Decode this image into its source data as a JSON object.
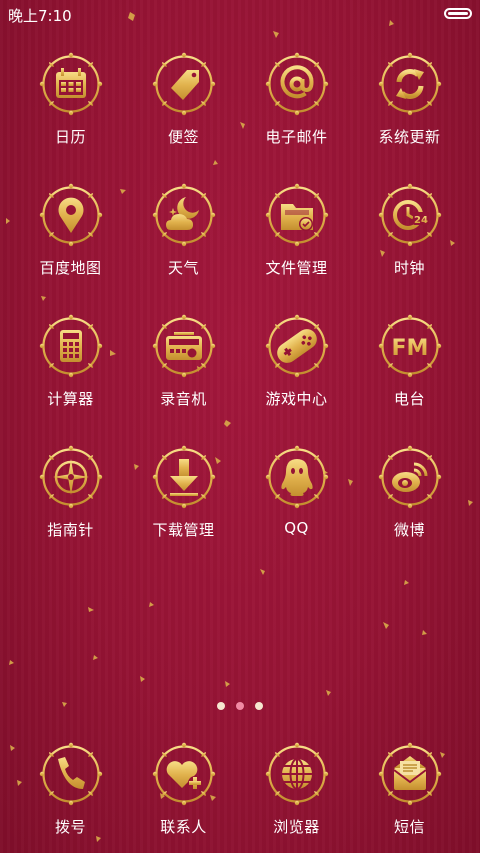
{
  "status_bar": {
    "time": "晚上7:10"
  },
  "colors": {
    "background": "#951334",
    "gold": "#e8c25a",
    "gold_dark": "#b98a2a"
  },
  "apps": [
    {
      "label": "日历",
      "icon": "calendar-icon"
    },
    {
      "label": "便签",
      "icon": "tag-icon"
    },
    {
      "label": "电子邮件",
      "icon": "at-sign-icon"
    },
    {
      "label": "系统更新",
      "icon": "refresh-icon"
    },
    {
      "label": "百度地图",
      "icon": "map-pin-icon"
    },
    {
      "label": "天气",
      "icon": "weather-moon-cloud-icon"
    },
    {
      "label": "文件管理",
      "icon": "folder-icon"
    },
    {
      "label": "时钟",
      "icon": "clock-24-icon"
    },
    {
      "label": "计算器",
      "icon": "calculator-icon"
    },
    {
      "label": "录音机",
      "icon": "radio-recorder-icon"
    },
    {
      "label": "游戏中心",
      "icon": "gamepad-icon"
    },
    {
      "label": "电台",
      "icon": "fm-radio-icon"
    },
    {
      "label": "指南针",
      "icon": "compass-icon"
    },
    {
      "label": "下载管理",
      "icon": "download-arrow-icon"
    },
    {
      "label": "QQ",
      "icon": "qq-penguin-icon"
    },
    {
      "label": "微博",
      "icon": "weibo-icon"
    }
  ],
  "page_indicator": {
    "count": 3,
    "active": 2
  },
  "dock": [
    {
      "label": "拨号",
      "icon": "phone-icon"
    },
    {
      "label": "联系人",
      "icon": "contact-heart-icon"
    },
    {
      "label": "浏览器",
      "icon": "globe-icon"
    },
    {
      "label": "短信",
      "icon": "envelope-icon"
    }
  ]
}
